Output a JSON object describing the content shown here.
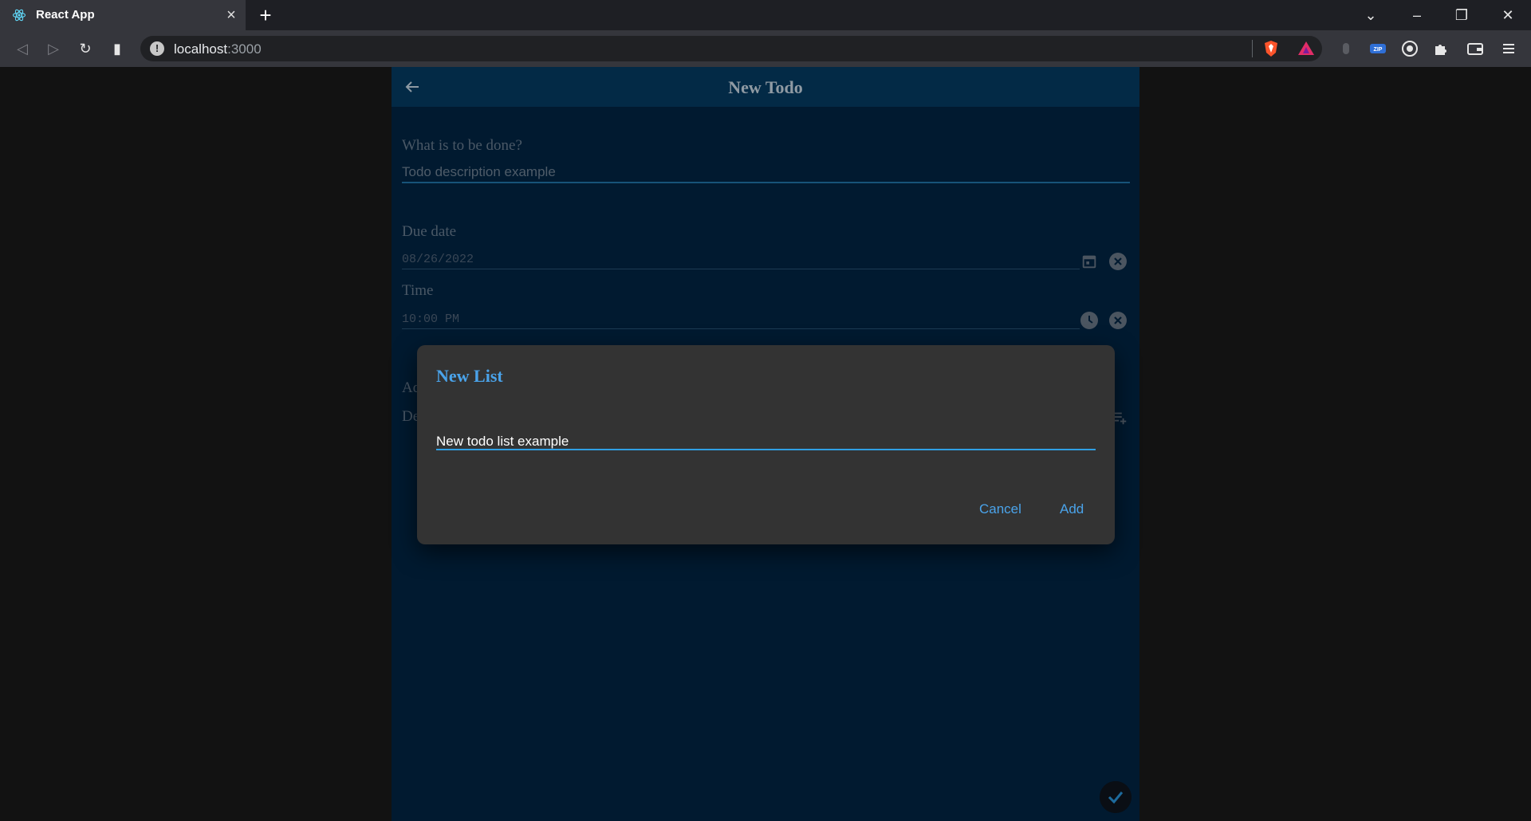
{
  "browser": {
    "tab_title": "React App",
    "url_host": "localhost",
    "url_port": ":3000"
  },
  "app": {
    "title": "New Todo",
    "description_label": "What is to be done?",
    "description_value": "Todo description example",
    "due_date_label": "Due date",
    "due_date_value": "08/26/2022",
    "time_label": "Time",
    "time_value": "10:00 PM",
    "partial_label_1": "Ad",
    "partial_label_2": "De"
  },
  "dialog": {
    "title": "New List",
    "input_value": "New todo list example",
    "cancel_label": "Cancel",
    "add_label": "Add"
  },
  "colors": {
    "accent": "#4aa3ea",
    "app_background": "#011a30",
    "appbar": "#032a46",
    "dialog_background": "#333333"
  }
}
